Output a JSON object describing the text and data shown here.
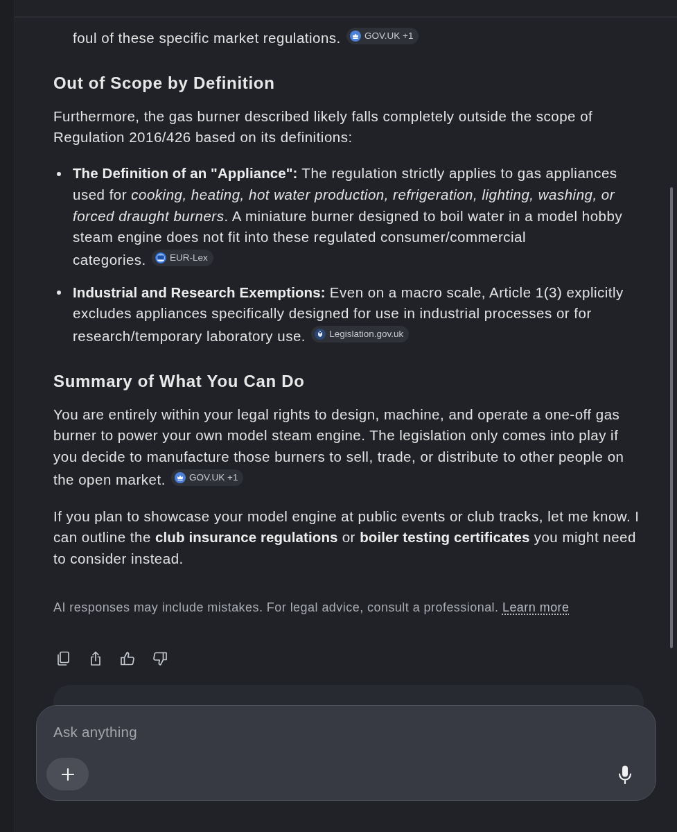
{
  "answer": {
    "blocks": [
      {
        "kind": "continuation",
        "text": "foul of these specific market regulations.",
        "citation": {
          "kind": "gov",
          "label": "GOV.UK +1"
        }
      },
      {
        "kind": "heading",
        "text": "Out of Scope by Definition"
      },
      {
        "kind": "paragraph",
        "text": "Furthermore, the gas burner described likely falls completely outside the scope of Regulation 2016/426 based on its definitions:"
      },
      {
        "kind": "bullets",
        "items": [
          {
            "text": "**The Definition of an \"Appliance\":** The regulation strictly applies to gas appliances used for *cooking, heating, hot water production, refrigeration, lighting, washing, or forced draught burners*. A miniature burner designed to boil water in a model hobby steam engine does not fit into these regulated consumer/commercial categories.",
            "citation": {
              "kind": "eu",
              "label": "EUR-Lex"
            }
          },
          {
            "text": "**Industrial and Research Exemptions:** Even on a macro scale, Article 1(3) explicitly excludes appliances specifically designed for use in industrial processes or for research/temporary laboratory use.",
            "citation": {
              "kind": "legislation",
              "label": "Legislation.gov.uk"
            }
          }
        ]
      },
      {
        "kind": "heading",
        "text": "Summary of What You Can Do"
      },
      {
        "kind": "paragraph",
        "text": "You are entirely within your legal rights to design, machine, and operate a one-off gas burner to power your own model steam engine. The legislation only comes into play if you decide to manufacture those burners to sell, trade, or distribute to other people on the open market.",
        "citation": {
          "kind": "gov",
          "label": "GOV.UK +1"
        }
      },
      {
        "kind": "paragraph",
        "text": "If you plan to showcase your model engine at public events or club tracks, let me know. I can outline the **club insurance regulations** or **boiler testing certificates** you might need to consider instead."
      }
    ],
    "disclaimer": {
      "text": "AI responses may include mistakes. For legal advice, consult a professional.",
      "link": "Learn more"
    }
  },
  "composer": {
    "placeholder": "Ask anything"
  }
}
